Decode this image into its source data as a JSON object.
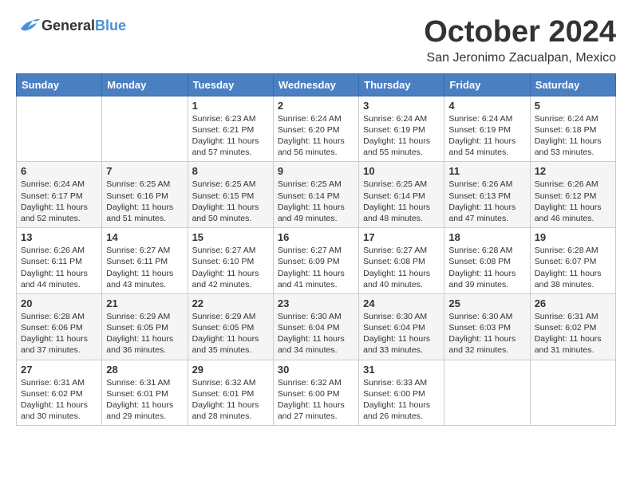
{
  "logo": {
    "general": "General",
    "blue": "Blue"
  },
  "title": "October 2024",
  "location": "San Jeronimo Zacualpan, Mexico",
  "headers": [
    "Sunday",
    "Monday",
    "Tuesday",
    "Wednesday",
    "Thursday",
    "Friday",
    "Saturday"
  ],
  "weeks": [
    {
      "shaded": false,
      "days": [
        {
          "num": "",
          "text": ""
        },
        {
          "num": "",
          "text": ""
        },
        {
          "num": "1",
          "text": "Sunrise: 6:23 AM\nSunset: 6:21 PM\nDaylight: 11 hours and 57 minutes."
        },
        {
          "num": "2",
          "text": "Sunrise: 6:24 AM\nSunset: 6:20 PM\nDaylight: 11 hours and 56 minutes."
        },
        {
          "num": "3",
          "text": "Sunrise: 6:24 AM\nSunset: 6:19 PM\nDaylight: 11 hours and 55 minutes."
        },
        {
          "num": "4",
          "text": "Sunrise: 6:24 AM\nSunset: 6:19 PM\nDaylight: 11 hours and 54 minutes."
        },
        {
          "num": "5",
          "text": "Sunrise: 6:24 AM\nSunset: 6:18 PM\nDaylight: 11 hours and 53 minutes."
        }
      ]
    },
    {
      "shaded": true,
      "days": [
        {
          "num": "6",
          "text": "Sunrise: 6:24 AM\nSunset: 6:17 PM\nDaylight: 11 hours and 52 minutes."
        },
        {
          "num": "7",
          "text": "Sunrise: 6:25 AM\nSunset: 6:16 PM\nDaylight: 11 hours and 51 minutes."
        },
        {
          "num": "8",
          "text": "Sunrise: 6:25 AM\nSunset: 6:15 PM\nDaylight: 11 hours and 50 minutes."
        },
        {
          "num": "9",
          "text": "Sunrise: 6:25 AM\nSunset: 6:14 PM\nDaylight: 11 hours and 49 minutes."
        },
        {
          "num": "10",
          "text": "Sunrise: 6:25 AM\nSunset: 6:14 PM\nDaylight: 11 hours and 48 minutes."
        },
        {
          "num": "11",
          "text": "Sunrise: 6:26 AM\nSunset: 6:13 PM\nDaylight: 11 hours and 47 minutes."
        },
        {
          "num": "12",
          "text": "Sunrise: 6:26 AM\nSunset: 6:12 PM\nDaylight: 11 hours and 46 minutes."
        }
      ]
    },
    {
      "shaded": false,
      "days": [
        {
          "num": "13",
          "text": "Sunrise: 6:26 AM\nSunset: 6:11 PM\nDaylight: 11 hours and 44 minutes."
        },
        {
          "num": "14",
          "text": "Sunrise: 6:27 AM\nSunset: 6:11 PM\nDaylight: 11 hours and 43 minutes."
        },
        {
          "num": "15",
          "text": "Sunrise: 6:27 AM\nSunset: 6:10 PM\nDaylight: 11 hours and 42 minutes."
        },
        {
          "num": "16",
          "text": "Sunrise: 6:27 AM\nSunset: 6:09 PM\nDaylight: 11 hours and 41 minutes."
        },
        {
          "num": "17",
          "text": "Sunrise: 6:27 AM\nSunset: 6:08 PM\nDaylight: 11 hours and 40 minutes."
        },
        {
          "num": "18",
          "text": "Sunrise: 6:28 AM\nSunset: 6:08 PM\nDaylight: 11 hours and 39 minutes."
        },
        {
          "num": "19",
          "text": "Sunrise: 6:28 AM\nSunset: 6:07 PM\nDaylight: 11 hours and 38 minutes."
        }
      ]
    },
    {
      "shaded": true,
      "days": [
        {
          "num": "20",
          "text": "Sunrise: 6:28 AM\nSunset: 6:06 PM\nDaylight: 11 hours and 37 minutes."
        },
        {
          "num": "21",
          "text": "Sunrise: 6:29 AM\nSunset: 6:05 PM\nDaylight: 11 hours and 36 minutes."
        },
        {
          "num": "22",
          "text": "Sunrise: 6:29 AM\nSunset: 6:05 PM\nDaylight: 11 hours and 35 minutes."
        },
        {
          "num": "23",
          "text": "Sunrise: 6:30 AM\nSunset: 6:04 PM\nDaylight: 11 hours and 34 minutes."
        },
        {
          "num": "24",
          "text": "Sunrise: 6:30 AM\nSunset: 6:04 PM\nDaylight: 11 hours and 33 minutes."
        },
        {
          "num": "25",
          "text": "Sunrise: 6:30 AM\nSunset: 6:03 PM\nDaylight: 11 hours and 32 minutes."
        },
        {
          "num": "26",
          "text": "Sunrise: 6:31 AM\nSunset: 6:02 PM\nDaylight: 11 hours and 31 minutes."
        }
      ]
    },
    {
      "shaded": false,
      "days": [
        {
          "num": "27",
          "text": "Sunrise: 6:31 AM\nSunset: 6:02 PM\nDaylight: 11 hours and 30 minutes."
        },
        {
          "num": "28",
          "text": "Sunrise: 6:31 AM\nSunset: 6:01 PM\nDaylight: 11 hours and 29 minutes."
        },
        {
          "num": "29",
          "text": "Sunrise: 6:32 AM\nSunset: 6:01 PM\nDaylight: 11 hours and 28 minutes."
        },
        {
          "num": "30",
          "text": "Sunrise: 6:32 AM\nSunset: 6:00 PM\nDaylight: 11 hours and 27 minutes."
        },
        {
          "num": "31",
          "text": "Sunrise: 6:33 AM\nSunset: 6:00 PM\nDaylight: 11 hours and 26 minutes."
        },
        {
          "num": "",
          "text": ""
        },
        {
          "num": "",
          "text": ""
        }
      ]
    }
  ]
}
